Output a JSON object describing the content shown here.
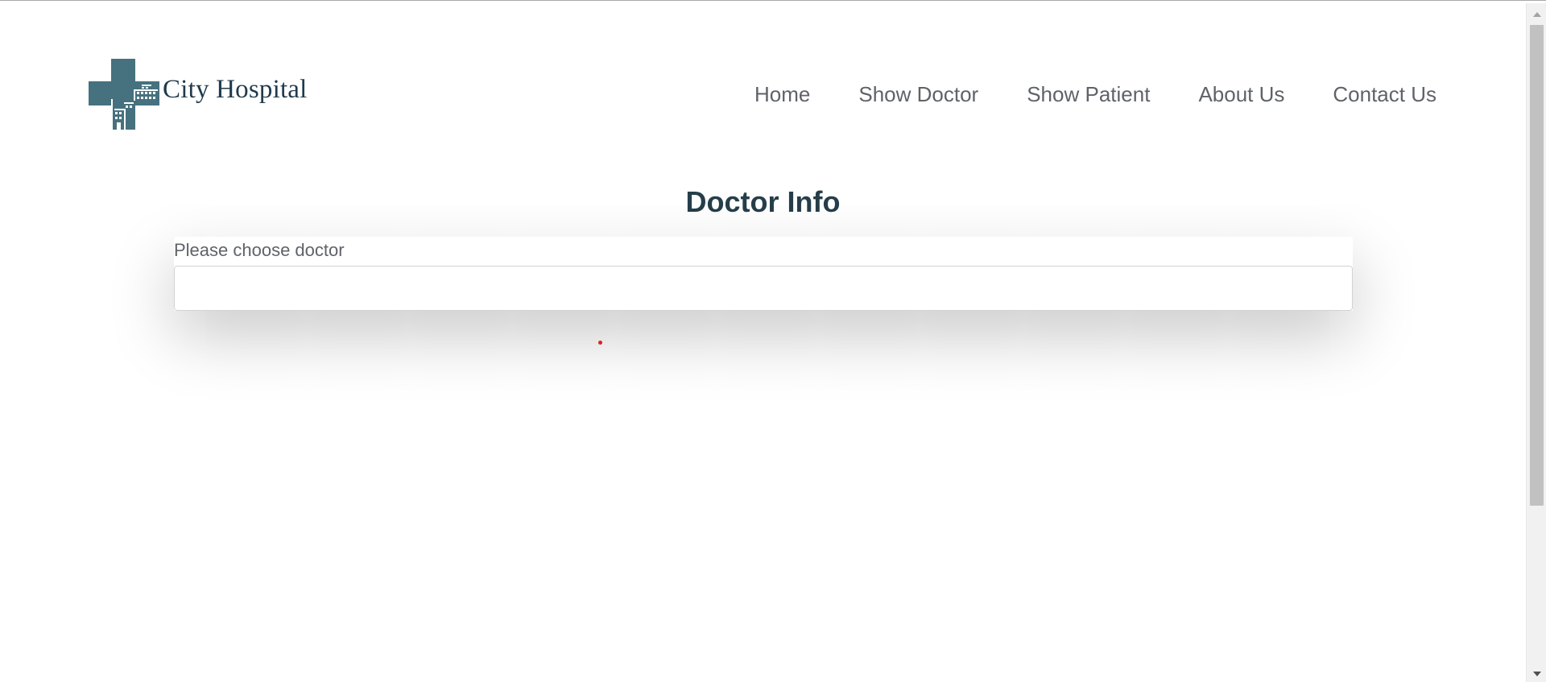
{
  "header": {
    "logo_text": "City Hospital",
    "nav": [
      {
        "label": "Home"
      },
      {
        "label": "Show Doctor"
      },
      {
        "label": "Show Patient"
      },
      {
        "label": "About Us"
      },
      {
        "label": "Contact Us"
      }
    ]
  },
  "main": {
    "title": "Doctor Info",
    "doctor_select": {
      "label": "Please choose doctor",
      "value": ""
    }
  },
  "colors": {
    "brand": "#46717f",
    "title": "#263e4a",
    "nav_text": "#5f6368",
    "dot": "#e0201c"
  },
  "icons": {
    "logo": "hospital-cross-logo-icon",
    "scroll_up": "scroll-up-arrow-icon",
    "scroll_down": "scroll-down-arrow-icon"
  }
}
